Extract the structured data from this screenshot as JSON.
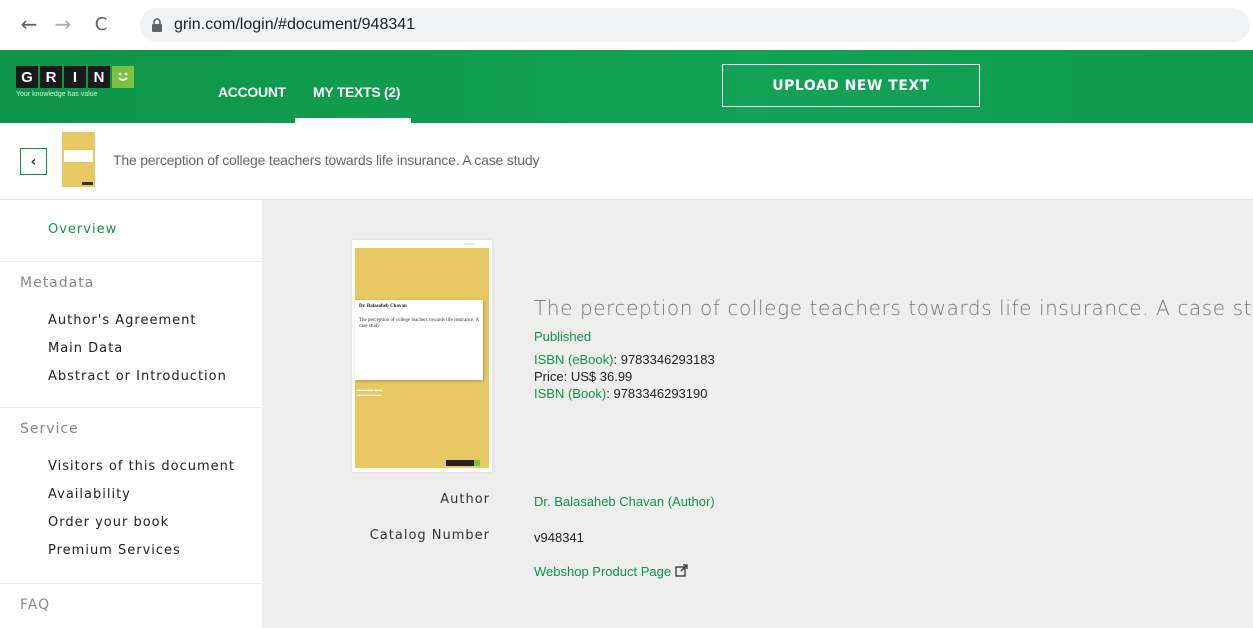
{
  "browser": {
    "url": "grin.com/login/#document/948341",
    "back_icon": "←",
    "forward_icon": "→",
    "reload_icon": "C"
  },
  "header": {
    "logo_letters": [
      "G",
      "R",
      "I",
      "N"
    ],
    "logo_smile": "˘̈",
    "tagline": "Your knowledge has value",
    "nav": [
      {
        "label": "ACCOUNT",
        "active": false
      },
      {
        "label": "MY TEXTS (2)",
        "active": true
      }
    ],
    "upload_label": "UPLOAD NEW TEXT",
    "colors": {
      "green": "#0e9448",
      "accent": "#7cc142"
    }
  },
  "document": {
    "title": "The perception of college teachers towards life insurance. A case study"
  },
  "sidebar": {
    "overview": "Overview",
    "sections": [
      {
        "heading": "Metadata",
        "items": [
          "Author's Agreement",
          "Main Data",
          "Abstract or Introduction"
        ]
      },
      {
        "heading": "Service",
        "items": [
          "Visitors of this document",
          "Availability",
          "Order your book",
          "Premium Services"
        ]
      },
      {
        "heading": "FAQ",
        "items": []
      }
    ]
  },
  "main": {
    "cover": {
      "author": "Dr. Balasaheb Chavan",
      "title": "The perception of college teachers towards life insurance. A case study"
    },
    "title": "The perception of college teachers towards life insurance. A case study",
    "status": "Published",
    "isbn_ebook_label": "ISBN (eBook)",
    "isbn_ebook": ": 9783346293183",
    "price": "Price: US$ 36.99",
    "isbn_book_label": "ISBN (Book)",
    "isbn_book": ": 9783346293190",
    "author_label": "Author",
    "author_value": "Dr. Balasaheb Chavan (Author)",
    "catalog_label": "Catalog Number",
    "catalog_value": "v948341",
    "webshop_label": "Webshop Product Page"
  }
}
